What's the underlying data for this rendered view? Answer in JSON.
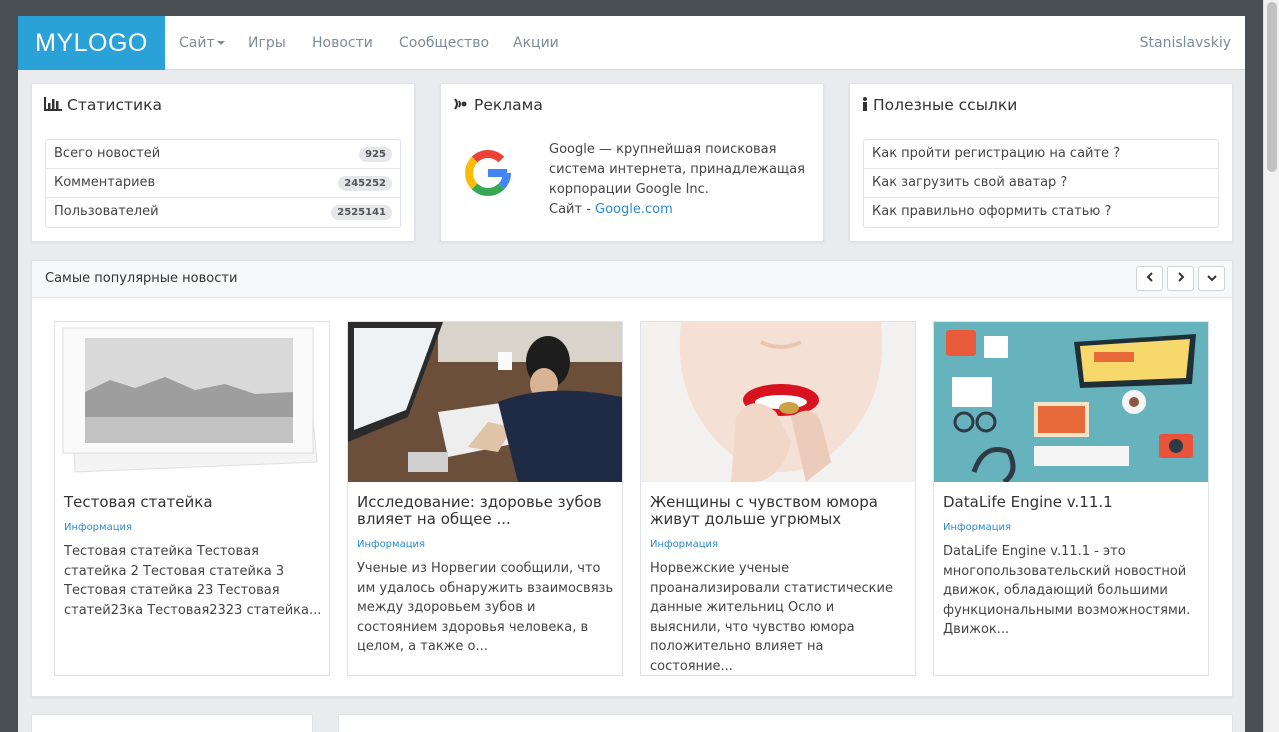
{
  "nav": {
    "logo": "MYLOGO",
    "items": [
      "Сайт",
      "Игры",
      "Новости",
      "Сообщество",
      "Акции"
    ],
    "user": "Stanislavskiy"
  },
  "stats": {
    "title": "Статистика",
    "rows": [
      {
        "label": "Всего новостей",
        "value": "925"
      },
      {
        "label": "Комментариев",
        "value": "245252"
      },
      {
        "label": "Пользователей",
        "value": "2525141"
      }
    ]
  },
  "ad": {
    "title": "Реклама",
    "text": "Google — крупнейшая поисковая система интернета, принадлежащая корпорации Google Inc.",
    "site_label": "Сайт - ",
    "site_link": "Google.com"
  },
  "links": {
    "title": "Полезные ссылки",
    "items": [
      "Как пройти регистрацию на сайте ?",
      "Как загрузить свой аватар ?",
      "Как правильно оформить статью ?"
    ]
  },
  "popular": {
    "title": "Самые популярные новости",
    "cards": [
      {
        "title": "Тестовая статейка",
        "category": "Информация",
        "text": "Тестовая статейка Тестовая статейка 2 Тестовая статейка  3 Тестовая статейка 23 Тестовая статей23ка Тестовая2323 статейка..."
      },
      {
        "title": "Исследование: здоровье зубов влияет на общее ...",
        "category": "Информация",
        "text": "Ученые из Норвегии сообщили, что им удалось обнаружить взаимосвязь между здоровьем зубов и состоянием здоровья человека, в целом, а также о..."
      },
      {
        "title": "Женщины с чувством юмора живут дольше угрюмых",
        "category": "Информация",
        "text": "Норвежские ученые проанализировали статистические данные жительниц Осло и выяснили, что чувство юмора положительно влияет на состояние..."
      },
      {
        "title": "DataLife Engine v.11.1",
        "category": "Информация",
        "text": "DataLife Engine v.11.1 - это многопользовательский новостной движок, обладающий большими функциональными возможностями. Движок..."
      }
    ]
  },
  "colors": {
    "brand": "#2aa2d8",
    "link": "#2a8ad2",
    "frame_bg": "#e9ebee",
    "outer_bg": "#4a4f56"
  },
  "icons": {
    "stats": "bar-chart-icon",
    "ad": "broadcast-icon",
    "links": "info-icon",
    "prev": "chevron-left-icon",
    "next": "chevron-right-icon",
    "collapse": "chevron-down-icon"
  }
}
